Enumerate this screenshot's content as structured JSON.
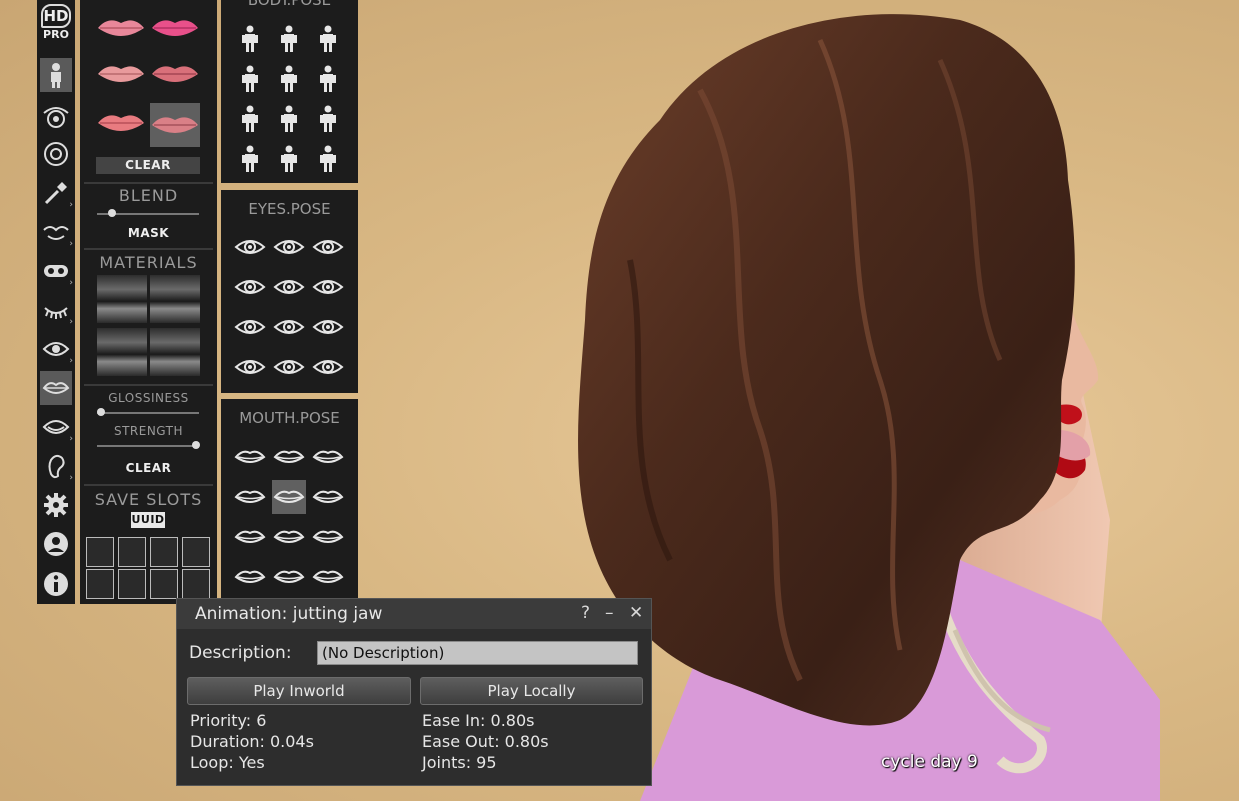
{
  "hud": {
    "logo_hd": "HD",
    "logo_pro": "PRO",
    "clear_label": "CLEAR",
    "blend_label": "BLEND",
    "mask_label": "MASK",
    "materials_label": "MATERIALS",
    "glossiness_label": "GLOSSINESS",
    "strength_label": "STRENGTH",
    "clear2_label": "CLEAR",
    "save_slots_label": "SAVE SLOTS",
    "uuid_label": "UUID",
    "body_pose_title": "BODY.POSE",
    "eyes_pose_title": "EYES.POSE",
    "mouth_pose_title": "MOUTH.POSE"
  },
  "floater": {
    "title": "Animation: jutting jaw",
    "help": "?",
    "minimize": "–",
    "close": "✕",
    "description_label": "Description:",
    "description_value": "(No Description)",
    "play_inworld": "Play Inworld",
    "play_locally": "Play Locally",
    "priority": "Priority: 6",
    "duration": "Duration: 0.04s",
    "loop": "Loop: Yes",
    "ease_in": "Ease In: 0.80s",
    "ease_out": "Ease Out: 0.80s",
    "joints": "Joints: 95"
  },
  "scene": {
    "cycle_label": "cycle day 9"
  },
  "colors": {
    "hud_bg": "#1c1c1c",
    "floater_bg": "#2d2d2d",
    "hair": "#4a2a1c",
    "top": "#d99ad8",
    "lips": "#c0101a"
  }
}
